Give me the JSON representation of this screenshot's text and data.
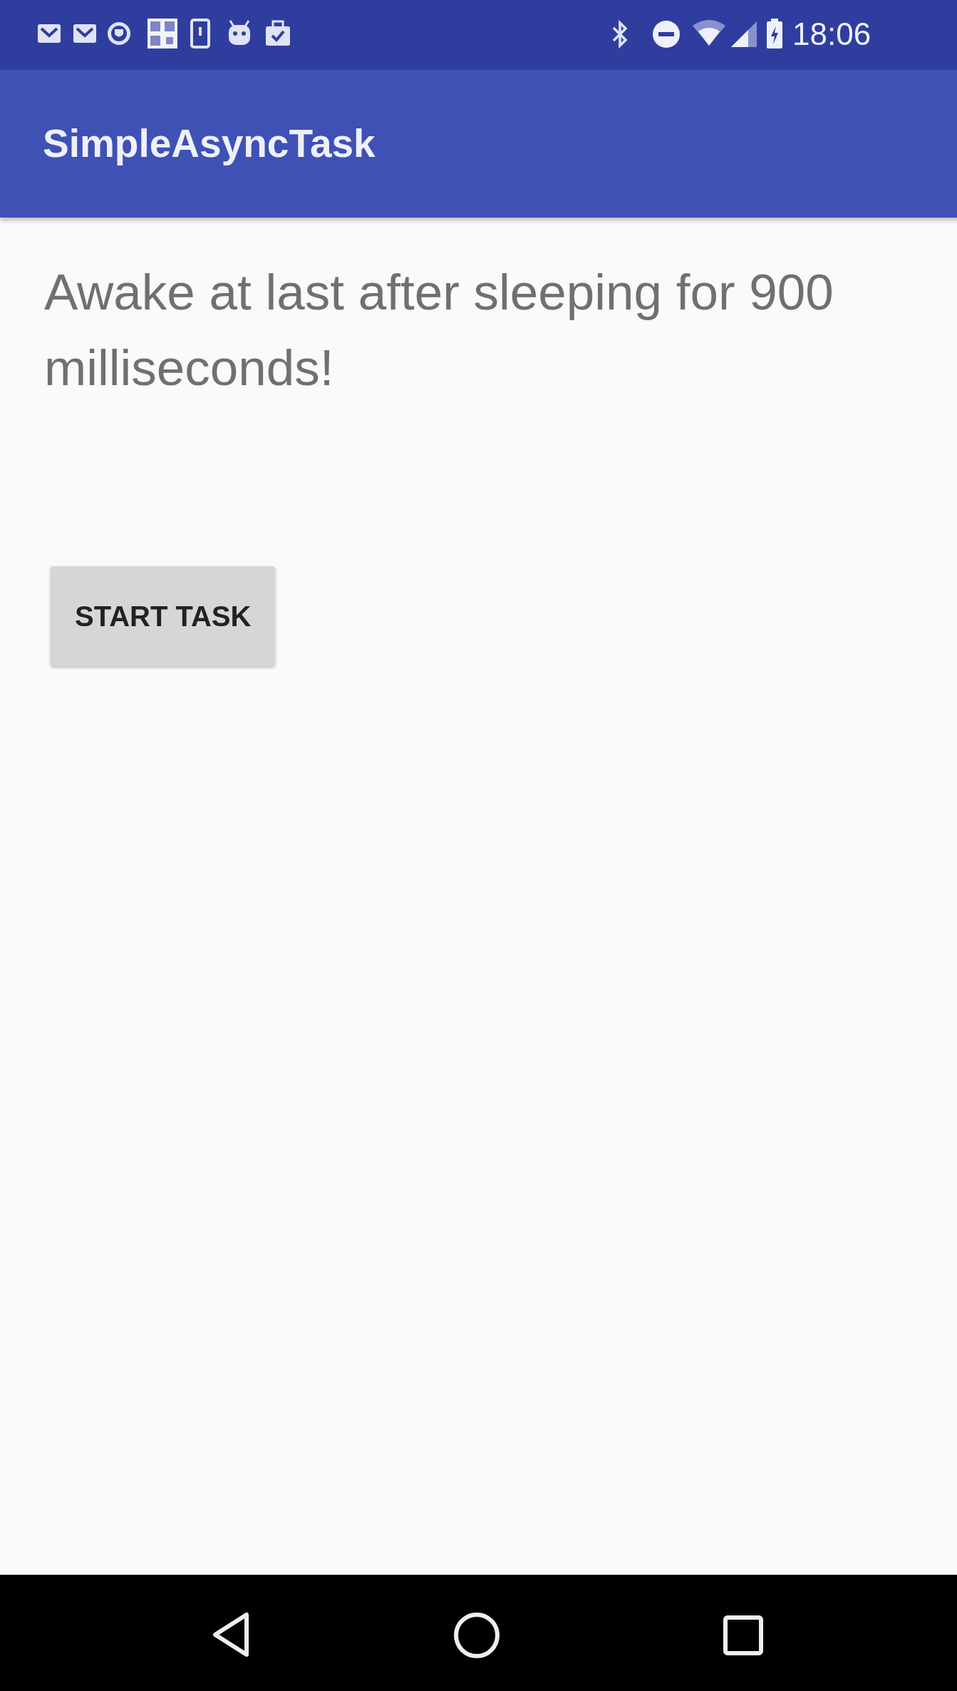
{
  "status_bar": {
    "time": "18:06"
  },
  "app_bar": {
    "title": "SimpleAsyncTask"
  },
  "message": "Awake at last after sleeping for 900 milliseconds!",
  "button": {
    "label": "START TASK"
  }
}
